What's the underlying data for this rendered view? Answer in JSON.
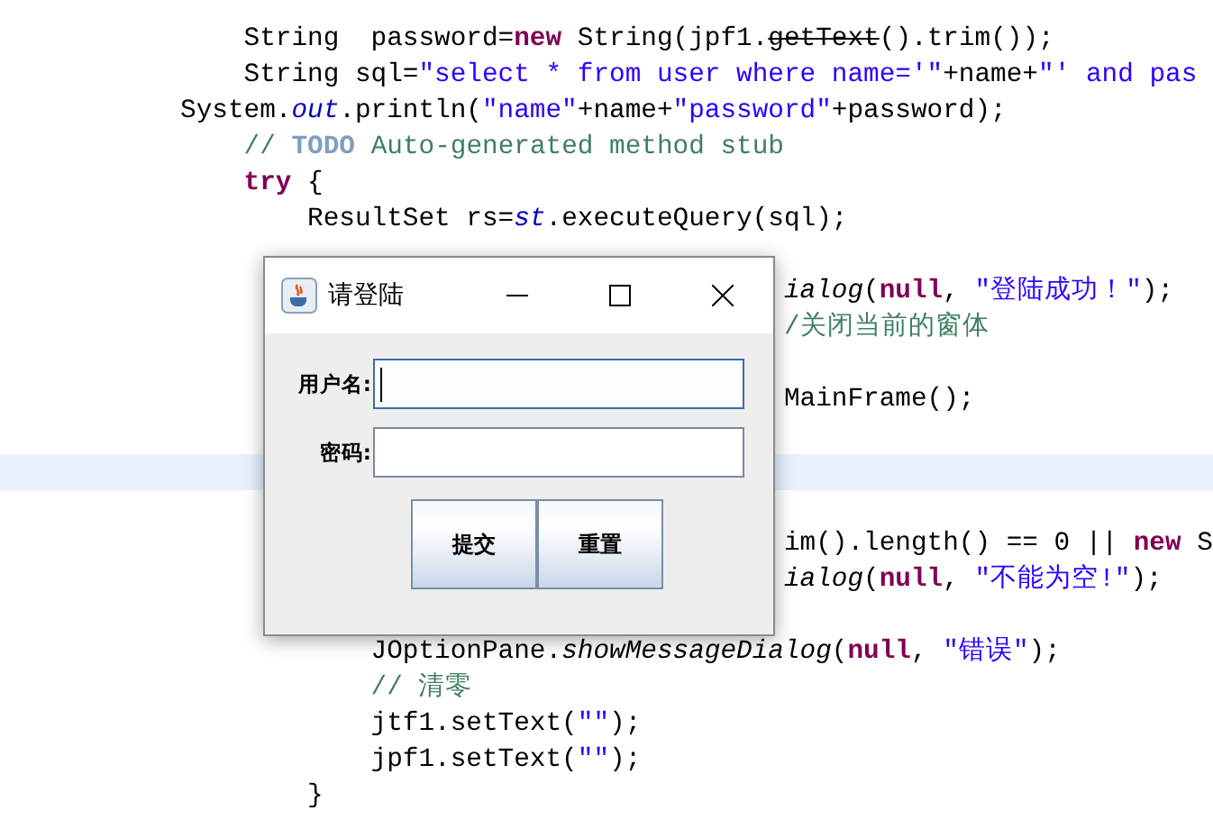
{
  "editor": {
    "lines": [
      {
        "current": false
      },
      {
        "current": false,
        "tokens": [
          {
            "kind": "plain",
            "text": "    String  password="
          },
          {
            "kind": "keyword",
            "text": "new"
          },
          {
            "kind": "plain",
            "text": " String(jpf1."
          },
          {
            "kind": "deprecated",
            "text": "getText"
          },
          {
            "kind": "plain",
            "text": "().trim());"
          }
        ]
      },
      {
        "current": false,
        "tokens": [
          {
            "kind": "plain",
            "text": "    String sql="
          },
          {
            "kind": "string",
            "text": "\"select * from user where name='\""
          },
          {
            "kind": "plain",
            "text": "+name+"
          },
          {
            "kind": "string",
            "text": "\"' and pas"
          }
        ]
      },
      {
        "current": false,
        "tokens": [
          {
            "kind": "plain",
            "text": "System."
          },
          {
            "kind": "field",
            "text": "out"
          },
          {
            "kind": "plain",
            "text": ".println("
          },
          {
            "kind": "string",
            "text": "\"name\""
          },
          {
            "kind": "plain",
            "text": "+name+"
          },
          {
            "kind": "string",
            "text": "\"password\""
          },
          {
            "kind": "plain",
            "text": "+password);"
          }
        ]
      },
      {
        "current": false,
        "tokens": [
          {
            "kind": "comment",
            "text": "    // "
          },
          {
            "kind": "todo",
            "text": "TODO"
          },
          {
            "kind": "comment",
            "text": " Auto-generated method stub"
          }
        ]
      },
      {
        "current": false,
        "tokens": [
          {
            "kind": "keyword",
            "text": "    try"
          },
          {
            "kind": "plain",
            "text": " {"
          }
        ]
      },
      {
        "current": false,
        "tokens": [
          {
            "kind": "plain",
            "text": "        ResultSet rs="
          },
          {
            "kind": "field",
            "text": "st"
          },
          {
            "kind": "plain",
            "text": ".executeQuery(sql);"
          }
        ]
      },
      {
        "current": false
      },
      {
        "current": false,
        "tokens": [
          {
            "kind": "method",
            "text": "                                      ialog"
          },
          {
            "kind": "plain",
            "text": "("
          },
          {
            "kind": "keyword",
            "text": "null"
          },
          {
            "kind": "plain",
            "text": ", "
          },
          {
            "kind": "string",
            "text": "\"登陆成功！\""
          },
          {
            "kind": "plain",
            "text": ");"
          }
        ]
      },
      {
        "current": false,
        "tokens": [
          {
            "kind": "comment",
            "text": "                                      /关闭当前的窗体"
          }
        ]
      },
      {
        "current": false
      },
      {
        "current": false,
        "tokens": [
          {
            "kind": "plain",
            "text": "                                      MainFrame();"
          }
        ]
      },
      {
        "current": false
      },
      {
        "current": true
      },
      {
        "current": false
      },
      {
        "current": false,
        "tokens": [
          {
            "kind": "plain",
            "text": "                                      im().length() == 0 || "
          },
          {
            "kind": "keyword",
            "text": "new"
          },
          {
            "kind": "plain",
            "text": " S"
          }
        ]
      },
      {
        "current": false,
        "tokens": [
          {
            "kind": "method",
            "text": "                                      ialog"
          },
          {
            "kind": "plain",
            "text": "("
          },
          {
            "kind": "keyword",
            "text": "null"
          },
          {
            "kind": "plain",
            "text": ", "
          },
          {
            "kind": "string",
            "text": "\"不能为空!\""
          },
          {
            "kind": "plain",
            "text": ");"
          }
        ]
      },
      {
        "current": false
      },
      {
        "current": false,
        "tokens": [
          {
            "kind": "plain",
            "text": "            JOptionPane."
          },
          {
            "kind": "method",
            "text": "showMessageDialog"
          },
          {
            "kind": "plain",
            "text": "("
          },
          {
            "kind": "keyword",
            "text": "null"
          },
          {
            "kind": "plain",
            "text": ", "
          },
          {
            "kind": "string",
            "text": "\"错误\""
          },
          {
            "kind": "plain",
            "text": ");"
          }
        ]
      },
      {
        "current": false,
        "tokens": [
          {
            "kind": "comment",
            "text": "            // 清零"
          }
        ]
      },
      {
        "current": false,
        "tokens": [
          {
            "kind": "plain",
            "text": "            jtf1.setText("
          },
          {
            "kind": "string",
            "text": "\"\""
          },
          {
            "kind": "plain",
            "text": ");"
          }
        ]
      },
      {
        "current": false,
        "tokens": [
          {
            "kind": "plain",
            "text": "            jpf1.setText("
          },
          {
            "kind": "string",
            "text": "\"\""
          },
          {
            "kind": "plain",
            "text": ");"
          }
        ]
      },
      {
        "current": false,
        "tokens": [
          {
            "kind": "plain",
            "text": "        }"
          }
        ]
      }
    ]
  },
  "dialog": {
    "title": "请登陆",
    "fields": [
      {
        "label": "用户名:",
        "focused": true
      },
      {
        "label": "密码:",
        "focused": false
      }
    ],
    "buttons": [
      "提交",
      "重置"
    ]
  }
}
